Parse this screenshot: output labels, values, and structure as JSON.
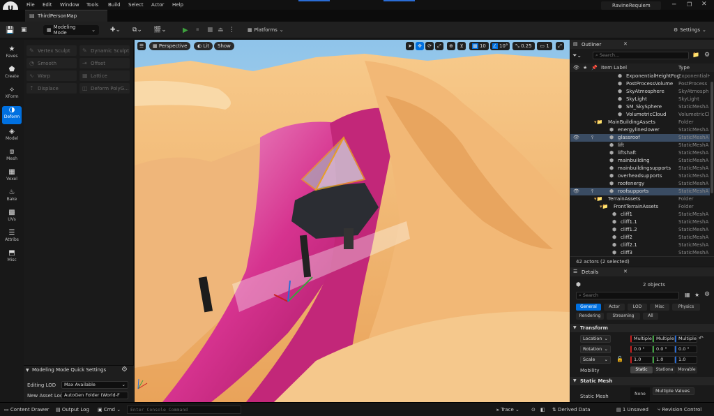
{
  "menu": [
    "File",
    "Edit",
    "Window",
    "Tools",
    "Build",
    "Select",
    "Actor",
    "Help"
  ],
  "tab": {
    "label": "ThirdPersonMap"
  },
  "project": "RavineRequiem",
  "toolbar": {
    "mode": "Modeling Mode",
    "platforms": "Platforms",
    "settings": "Settings"
  },
  "left_strip": [
    "Faves",
    "Create",
    "XForm",
    "Deform",
    "Model",
    "Mesh",
    "Voxel",
    "Bake",
    "UVs",
    "Attribs",
    "Misc"
  ],
  "tools": [
    "Vertex Sculpt",
    "Dynamic Sculpt",
    "Smooth",
    "Offset",
    "Warp",
    "Lattice",
    "Displace",
    "Deform PolyG..."
  ],
  "quick_settings": {
    "title": "Modeling Mode Quick Settings",
    "editing_lod_label": "Editing LOD",
    "editing_lod_value": "Max Available",
    "asset_loc_label": "New Asset Loca",
    "asset_loc_value": "AutoGen Folder (World-F"
  },
  "viewport": {
    "perspective": "Perspective",
    "lit": "Lit",
    "show": "Show",
    "grid": "10",
    "angle": "10°",
    "scale": "0.25",
    "cams": "1"
  },
  "outliner": {
    "title": "Outliner",
    "search_placeholder": "Search...",
    "col_label": "Item Label",
    "col_type": "Type",
    "rows": [
      {
        "label": "ExponentialHeightFog",
        "type": "ExponentialH"
      },
      {
        "label": "PostProcessVolume",
        "type": "PostProcess"
      },
      {
        "label": "SkyAtmosphere",
        "type": "SkyAtmosph"
      },
      {
        "label": "SkyLight",
        "type": "SkyLight"
      },
      {
        "label": "SM_SkySphere",
        "type": "StaticMeshA"
      },
      {
        "label": "VolumetricCloud",
        "type": "VolumetricCl"
      },
      {
        "label": "MainBuildingAssets",
        "type": "Folder"
      },
      {
        "label": "energylineslower",
        "type": "StaticMeshA"
      },
      {
        "label": "glassroof",
        "type": "StaticMeshA"
      },
      {
        "label": "lift",
        "type": "StaticMeshA"
      },
      {
        "label": "liftshaft",
        "type": "StaticMeshA"
      },
      {
        "label": "mainbuilding",
        "type": "StaticMeshA"
      },
      {
        "label": "mainbuildingsupports",
        "type": "StaticMeshA"
      },
      {
        "label": "overheadsupports",
        "type": "StaticMeshA"
      },
      {
        "label": "roofenergy",
        "type": "StaticMeshA"
      },
      {
        "label": "roofsupports",
        "type": "StaticMeshA"
      },
      {
        "label": "TerrainAssets",
        "type": "Folder"
      },
      {
        "label": "FrontTerrainAssets",
        "type": "Folder"
      },
      {
        "label": "cliff1",
        "type": "StaticMeshA"
      },
      {
        "label": "cliff1.1",
        "type": "StaticMeshA"
      },
      {
        "label": "cliff1.2",
        "type": "StaticMeshA"
      },
      {
        "label": "cliff2",
        "type": "StaticMeshA"
      },
      {
        "label": "cliff2.1",
        "type": "StaticMeshA"
      },
      {
        "label": "cliff3",
        "type": "StaticMeshA"
      }
    ],
    "footer": "42 actors (2 selected)"
  },
  "details": {
    "title": "Details",
    "objects": "2 objects",
    "search_placeholder": "Search",
    "filters": [
      "General",
      "Actor",
      "LOD",
      "Misc",
      "Physics",
      "Rendering",
      "Streaming",
      "All"
    ],
    "transform_title": "Transform",
    "location": "Location",
    "rotation": "Rotation",
    "scale": "Scale",
    "loc_vals": [
      "Multiple",
      "Multiple",
      "Multiple"
    ],
    "rot_vals": [
      "0.0 °",
      "0.0 °",
      "0.0 °"
    ],
    "scale_vals": [
      "1.0",
      "1.0",
      "1.0"
    ],
    "mobility": "Mobility",
    "mobility_opts": [
      "Static",
      "Stationa",
      "Movable"
    ],
    "static_mesh_title": "Static Mesh",
    "static_mesh_label": "Static Mesh",
    "none": "None",
    "multiple_values": "Multiple Values"
  },
  "statusbar": {
    "content_drawer": "Content Drawer",
    "output_log": "Output Log",
    "cmd": "Cmd",
    "console_placeholder": "Enter Console Command",
    "trace": "Trace",
    "derived": "Derived Data",
    "unsaved": "1 Unsaved",
    "revision": "Revision Control"
  },
  "colors": {
    "accent": "#0070e0",
    "selected_row": "#3a4c63",
    "play": "#3ea13e"
  }
}
